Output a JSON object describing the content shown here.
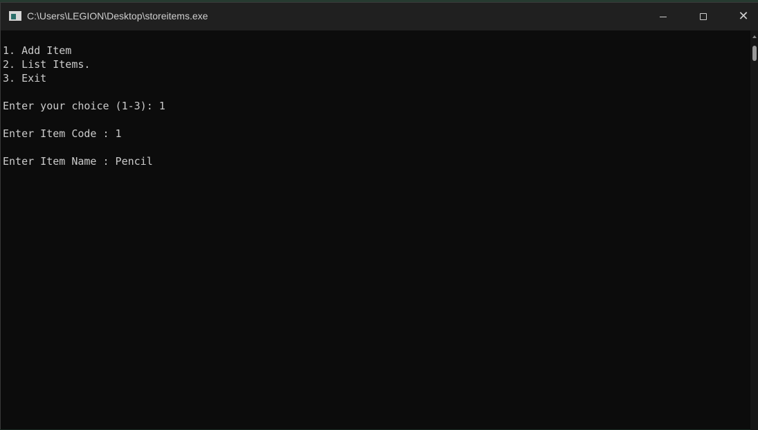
{
  "window": {
    "title": "C:\\Users\\LEGION\\Desktop\\storeitems.exe",
    "icon": "console-app-icon",
    "controls": {
      "minimize": "minimize-icon",
      "maximize": "maximize-icon",
      "close": "close-icon"
    }
  },
  "console": {
    "lines": [
      "1. Add Item",
      "2. List Items.",
      "3. Exit",
      "",
      "Enter your choice (1-3): 1",
      "",
      "Enter Item Code : 1",
      "",
      "Enter Item Name : Pencil"
    ]
  },
  "colors": {
    "console_background": "#0c0c0c",
    "console_text": "#cccccc",
    "titlebar": "#202020"
  }
}
